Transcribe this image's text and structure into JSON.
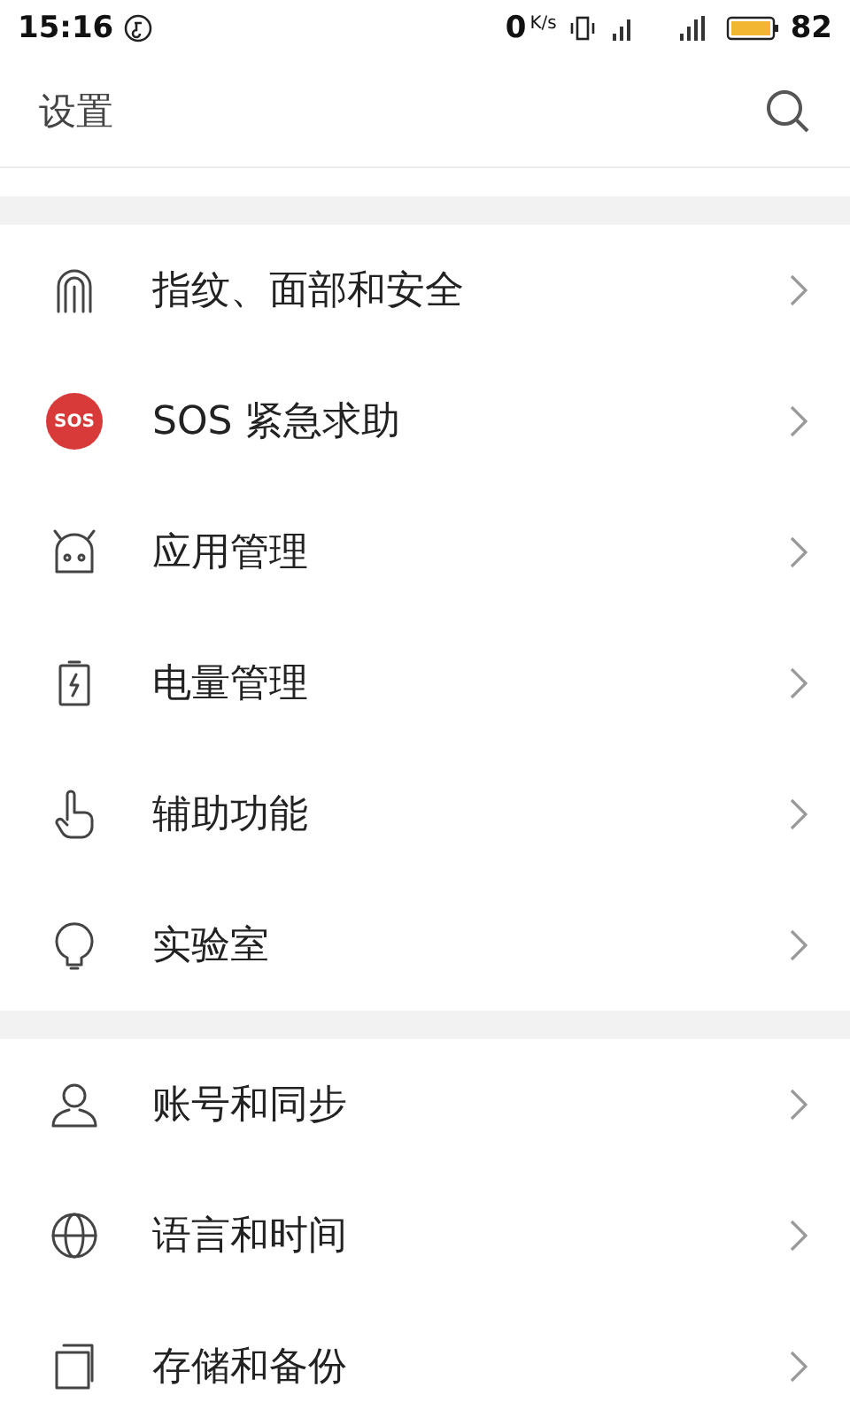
{
  "status_bar": {
    "time": "15:16",
    "speed": "0",
    "speed_unit": "K/s",
    "battery": "82"
  },
  "header": {
    "title": "设置"
  },
  "sections": [
    {
      "items": [
        {
          "kind": "fingerprint",
          "label": "指纹、面部和安全"
        },
        {
          "kind": "sos",
          "label": "SOS 紧急求助",
          "badge": "SOS"
        },
        {
          "kind": "robot",
          "label": "应用管理"
        },
        {
          "kind": "battery",
          "label": "电量管理"
        },
        {
          "kind": "hand",
          "label": "辅助功能"
        },
        {
          "kind": "bulb",
          "label": "实验室"
        }
      ]
    },
    {
      "items": [
        {
          "kind": "person",
          "label": "账号和同步"
        },
        {
          "kind": "globe",
          "label": "语言和时间"
        },
        {
          "kind": "storage",
          "label": "存储和备份"
        }
      ]
    }
  ]
}
